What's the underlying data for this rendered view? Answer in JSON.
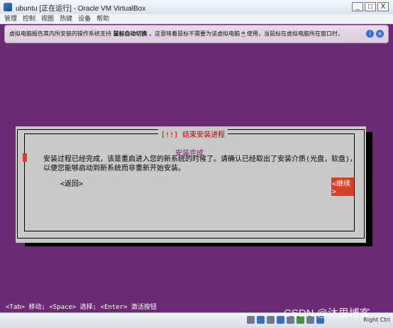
{
  "window": {
    "title": "ubuntu [正在运行] - Oracle VM VirtualBox",
    "controls": {
      "minimize": "_",
      "maximize": "□",
      "close": "X"
    }
  },
  "menu": {
    "items": [
      "管理",
      "控制",
      "视图",
      "热键",
      "设备",
      "帮助"
    ]
  },
  "notification": {
    "text_before": "虚拟电脑报告其内所安装的操作系统支持",
    "bold": "鼠标自动切换",
    "text_after": "。这意味着鼠标不需要为该虚拟电脑",
    "text_end": "使用，当鼠标在虚拟电脑所在窗口时，"
  },
  "dialog": {
    "title": "[!!] 结束安装进程",
    "heading": "安装完成",
    "body": "安装过程已经完成，该是重启进入您的新系统的时候了。请确认已经取出了安装介质(光盘，软盘)，以便您能够启动到新系统而非重新开始安装。",
    "back_button": "<返回>",
    "continue_button": "<继续>"
  },
  "footer_hint": "<Tab> 移动; <Space> 选择; <Enter> 激活按钮",
  "statusbar": {
    "watermark": "CSDN @沐里博客",
    "host_key": "Right Ctrl"
  }
}
